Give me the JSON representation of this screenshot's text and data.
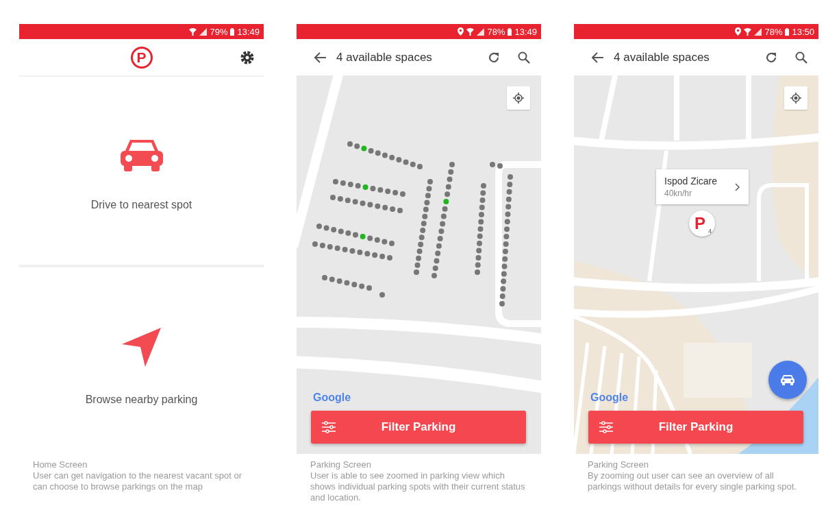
{
  "screens": [
    {
      "kind": "home",
      "status_bar": {
        "location": false,
        "battery": "79%",
        "time": "13:49"
      },
      "logo": "P",
      "options": [
        {
          "kind": "car",
          "label": "Drive to nearest spot"
        },
        {
          "kind": "navigate",
          "label": "Browse nearby parking"
        }
      ],
      "caption": {
        "title": "Home Screen",
        "text": "User can get navigation to the nearest vacant spot or can choose to browse parkings on the map"
      }
    },
    {
      "kind": "spots",
      "status_bar": {
        "location": true,
        "battery": "78%",
        "time": "13:49"
      },
      "header": {
        "title": "4 available spaces"
      },
      "map": {
        "spot_rows": [
          {
            "available": [
              false,
              false,
              true,
              false,
              false,
              false,
              false,
              false,
              false,
              false,
              false
            ]
          },
          {
            "available": [
              false,
              false,
              false,
              false,
              true,
              false,
              false,
              false,
              false,
              false
            ]
          },
          {
            "available": [
              false,
              false,
              false,
              false,
              false,
              false,
              false,
              false,
              false,
              false
            ]
          },
          {
            "available": [
              false,
              false,
              false,
              false,
              false,
              false,
              true,
              false,
              false,
              false,
              false
            ]
          },
          {
            "available": [
              false,
              false,
              false,
              false,
              false,
              false,
              false,
              false,
              false,
              false,
              false
            ]
          },
          {
            "available": [
              false,
              false,
              false,
              false,
              false,
              false,
              false
            ]
          },
          {
            "available": [
              false
            ]
          },
          {
            "available": [
              false,
              false,
              false,
              false,
              false,
              false,
              false,
              false,
              false,
              false,
              false,
              false,
              false,
              false
            ]
          },
          {
            "available": [
              false,
              false,
              false,
              false,
              false,
              true,
              false,
              false,
              false,
              false,
              false,
              false,
              false,
              false,
              false,
              false
            ]
          },
          {
            "available": [
              false,
              false,
              false,
              false,
              false,
              false,
              false,
              false,
              false,
              false,
              false,
              false,
              false
            ]
          },
          {
            "available": [
              false,
              false
            ]
          },
          {
            "available": [
              false,
              false,
              false,
              false,
              false,
              false,
              false,
              false,
              false,
              false,
              false,
              false,
              false,
              false,
              false,
              false,
              false,
              false
            ]
          }
        ]
      },
      "google": "Google",
      "filter_button": "Filter Parking",
      "caption": {
        "title": "Parking Screen",
        "text": "User is able to see zoomed in parking view which shows individual parking spots with their current status and location."
      }
    },
    {
      "kind": "overview",
      "status_bar": {
        "location": true,
        "battery": "78%",
        "time": "13:50"
      },
      "header": {
        "title": "4 available spaces"
      },
      "map": {
        "callout": {
          "title": "Ispod Zicare",
          "price": "40kn/hr"
        },
        "marker": {
          "letter": "P",
          "count": "4"
        }
      },
      "google": "Google",
      "filter_button": "Filter Parking",
      "caption": {
        "title": "Parking Screen",
        "text": "By zooming out user can see an overview of all parkings without details for every single parking spot."
      }
    }
  ]
}
